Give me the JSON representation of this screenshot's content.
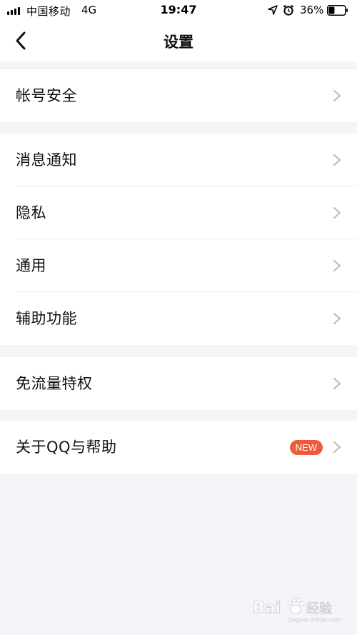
{
  "status_bar": {
    "carrier": "中国移动",
    "network": "4G",
    "time": "19:47",
    "battery_percent": "36%",
    "battery_level": 0.36,
    "icons": [
      "signal-icon",
      "location-icon",
      "alarm-icon",
      "battery-icon"
    ]
  },
  "nav": {
    "title": "设置",
    "back_icon": "chevron-left-icon"
  },
  "groups": [
    {
      "items": [
        {
          "label": "帐号安全"
        }
      ]
    },
    {
      "items": [
        {
          "label": "消息通知"
        },
        {
          "label": "隐私"
        },
        {
          "label": "通用"
        },
        {
          "label": "辅助功能"
        }
      ]
    },
    {
      "items": [
        {
          "label": "免流量特权"
        }
      ]
    },
    {
      "items": [
        {
          "label": "关于QQ与帮助",
          "badge": "NEW"
        }
      ]
    }
  ],
  "watermark": {
    "text_latin": "Bai",
    "text_cn": "经验",
    "sub": "jingyan.baidu.com"
  },
  "colors": {
    "background": "#f4f5f8",
    "surface": "#ffffff",
    "badge": "#ee5a3a",
    "chevron": "#b8b8be"
  }
}
